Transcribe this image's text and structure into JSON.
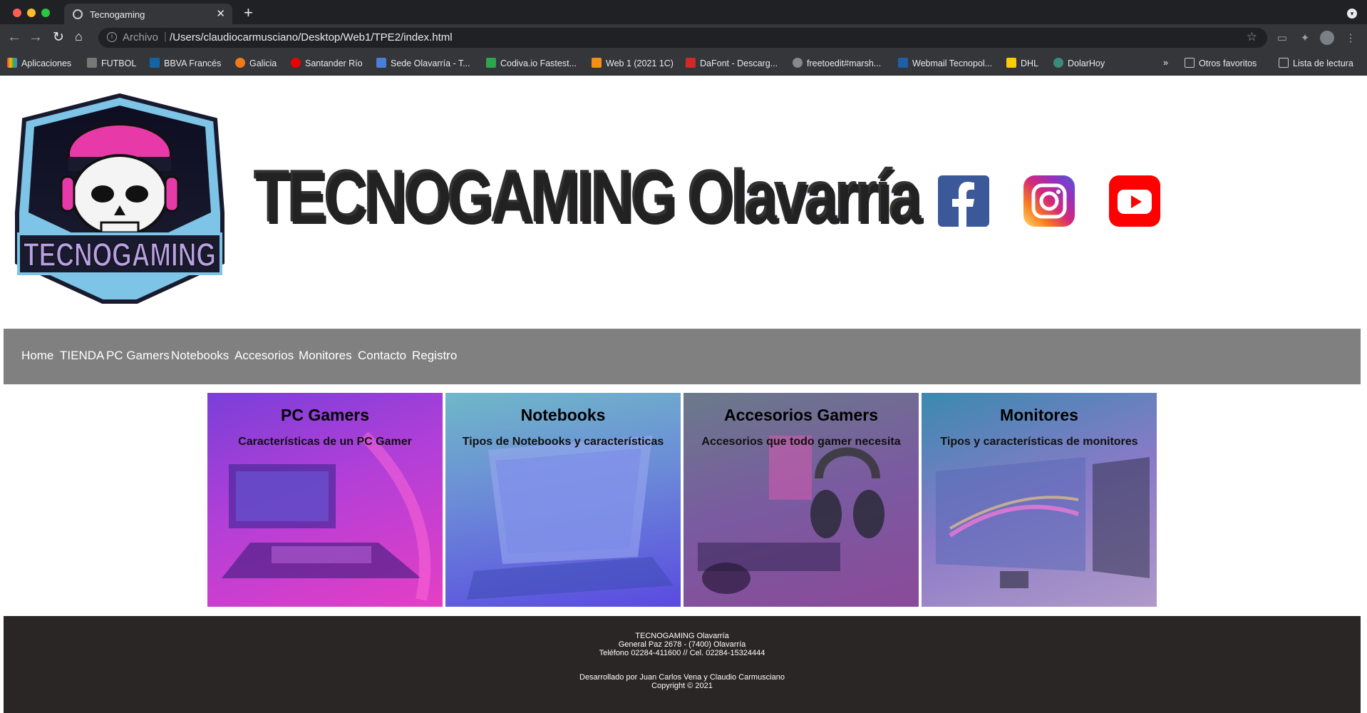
{
  "browser": {
    "tab_title": "Tecnogaming",
    "tab_close": "✕",
    "new_tab": "+",
    "url_scheme": "Archivo",
    "url": "/Users/claudiocarmusciano/Desktop/Web1/TPE2/index.html",
    "bookmarks": [
      "Aplicaciones",
      "FUTBOL",
      "BBVA Francés",
      "Galicia",
      "Santander Río",
      "Sede Olavarría - T...",
      "Codiva.io Fastest...",
      "Web 1 (2021 1C)",
      "DaFont - Descarg...",
      "freetoedit#marsh...",
      "Webmail Tecnopol...",
      "DHL",
      "DolarHoy"
    ],
    "bookmark_overflow": "»",
    "other_favorites": "Otros favoritos",
    "reading_list": "Lista de lectura"
  },
  "header": {
    "logo_text": "TECNOGAMING",
    "brand_title": "TECNOGAMING Olavarría",
    "social_icons": [
      "facebook-icon",
      "instagram-icon",
      "youtube-icon"
    ]
  },
  "nav": [
    "Home",
    "TIENDA",
    "PC Gamers",
    "Notebooks",
    "Accesorios",
    "Monitores",
    "Contacto",
    "Registro"
  ],
  "cards": [
    {
      "title": "PC Gamers",
      "subtitle": "Características de un PC Gamer"
    },
    {
      "title": "Notebooks",
      "subtitle": "Tipos de Notebooks y características"
    },
    {
      "title": "Accesorios Gamers",
      "subtitle": "Accesorios que todo gamer necesita"
    },
    {
      "title": "Monitores",
      "subtitle": "Tipos y características de monitores"
    }
  ],
  "footer": {
    "name": "TECNOGAMING Olavarría",
    "address": "General Paz 2678 - (7400) Olavarría",
    "phone": "Teléfono 02284-411600 // Cel. 02284-15324444",
    "developers": "Desarrollado por Juan Carlos Vena y Claudio Carmusciano",
    "copyright": "Copyright © 2021"
  }
}
